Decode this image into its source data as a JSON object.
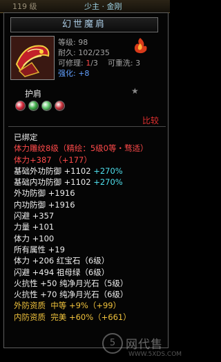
{
  "header": {
    "level_fragment": "119 级",
    "char_name": "少主 · 金刚"
  },
  "item": {
    "name": "幻世魔肩",
    "icon": "pauldron-icon",
    "emblem_icon": "flame-emblem-icon",
    "stats": [
      [
        {
          "text": "等级: ",
          "color": "gray"
        },
        {
          "text": "98",
          "color": "gray"
        }
      ],
      [
        {
          "text": "耐久: ",
          "color": "gray"
        },
        {
          "text": "102/235",
          "color": "gray"
        }
      ],
      [
        {
          "text": "可修理: ",
          "color": "gray"
        },
        {
          "text": "1",
          "color": "red"
        },
        {
          "text": "/3",
          "color": "gray"
        },
        {
          "text": "    可重洗: ",
          "color": "gray"
        },
        {
          "text": "3",
          "color": "gray"
        }
      ],
      [
        {
          "text": "强化: ",
          "color": "blue"
        },
        {
          "text": "+8",
          "color": "blue"
        }
      ]
    ]
  },
  "slot_label": "护肩",
  "gems": [
    {
      "name": "red-gem-icon",
      "color": "#d8283a"
    },
    {
      "name": "green-gem-icon",
      "color": "#3fae48"
    },
    {
      "name": "green-gem-icon",
      "color": "#5ec66a"
    },
    {
      "name": "red-gem-icon",
      "color": "#c8303a"
    }
  ],
  "compare_label": "比较",
  "attributes": [
    [
      {
        "text": "已绑定",
        "color": "white"
      }
    ],
    [
      {
        "text": "体力雕纹8级（精绘：5级0等・骛适）",
        "color": "red"
      }
    ],
    [
      {
        "text": "体力+387 ",
        "color": "red"
      },
      {
        "text": "（+177）",
        "color": "red"
      }
    ],
    [
      {
        "text": "基础外功防御 +1102 ",
        "color": "white"
      },
      {
        "text": "+270%",
        "color": "cyan"
      }
    ],
    [
      {
        "text": "基础内功防御 +1102 ",
        "color": "white"
      },
      {
        "text": "+270%",
        "color": "cyan"
      }
    ],
    [
      {
        "text": "外功防御 +1916",
        "color": "white"
      }
    ],
    [
      {
        "text": "内功防御 +1916",
        "color": "white"
      }
    ],
    [
      {
        "text": "闪避 +357",
        "color": "white"
      }
    ],
    [
      {
        "text": "力量 +101",
        "color": "white"
      }
    ],
    [
      {
        "text": "体力 +100",
        "color": "white"
      }
    ],
    [
      {
        "text": "所有属性 +19",
        "color": "white"
      }
    ],
    [
      {
        "text": "体力 +206 红宝石（6级）",
        "color": "white"
      }
    ],
    [
      {
        "text": "闪避 +494 祖母绿（6级）",
        "color": "white"
      }
    ],
    [
      {
        "text": "火抗性 +50 纯净月光石（5级）",
        "color": "white"
      }
    ],
    [
      {
        "text": "火抗性 +70 纯净月光石（6级）",
        "color": "white"
      }
    ],
    [
      {
        "text": "外防资质  中等 +9%（+99）",
        "color": "gold"
      }
    ],
    [
      {
        "text": "内防资质  完美 +60%（+661）",
        "color": "gold"
      }
    ]
  ],
  "watermark": {
    "text": "网代售",
    "url": "WWW.5XDS.COM",
    "circle_glyph": "5"
  }
}
